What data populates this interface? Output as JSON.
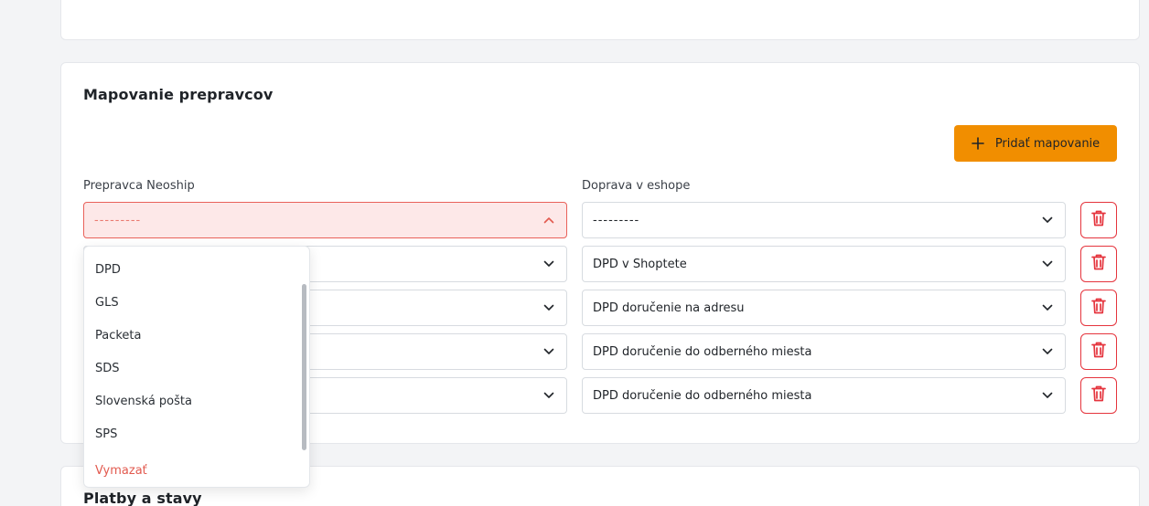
{
  "sections": {
    "carrier_mapping_title": "Mapovanie prepravcov",
    "payments_title": "Platby a stavy"
  },
  "actions": {
    "add_mapping_label": "Pridať mapovanie"
  },
  "columns": {
    "neoship_carrier": "Prepravca Neoship",
    "eshop_shipping": "Doprava v eshope"
  },
  "rows": [
    {
      "carrier": "---------",
      "shipping": "---------",
      "carrier_state": "error-open"
    },
    {
      "carrier": "",
      "shipping": "DPD v Shoptete"
    },
    {
      "carrier": "",
      "shipping": "DPD doručenie na adresu"
    },
    {
      "carrier": "",
      "shipping": "DPD doručenie do odberného miesta"
    },
    {
      "carrier": "",
      "shipping": "DPD doručenie do odberného miesta"
    }
  ],
  "dropdown": {
    "options": [
      "DPD",
      "GLS",
      "Packeta",
      "SDS",
      "Slovenská pošta",
      "SPS"
    ],
    "clear_label": "Vymazať"
  },
  "colors": {
    "accent": "#f18e00",
    "danger": "#e5343d",
    "error_bg": "#fde8e8",
    "error_border": "#e9615a"
  },
  "icons": {
    "add": "plus-icon",
    "select": "chevron-down-icon",
    "select_open": "chevron-up-icon",
    "delete": "trash-icon"
  }
}
